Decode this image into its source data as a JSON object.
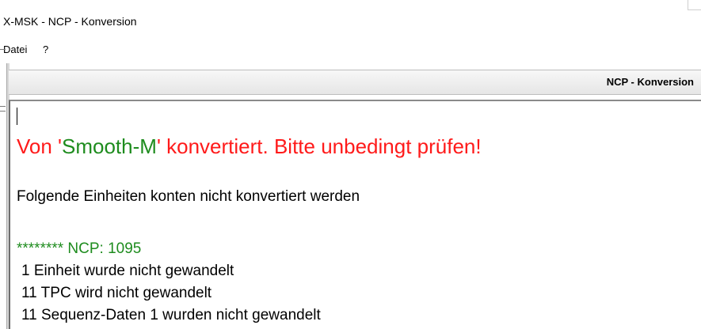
{
  "window": {
    "title": "X-MSK - NCP - Konversion"
  },
  "menu": {
    "items": [
      "Datei",
      "?"
    ]
  },
  "panel": {
    "title": "NCP - Konversion"
  },
  "content": {
    "headline": {
      "part1": "Von '",
      "source": "Smooth-M",
      "part2": "' konvertiert. Bitte unbedingt prüfen!"
    },
    "subheading": "Folgende Einheiten konten nicht konvertiert werden",
    "ncp_line": "******** NCP: 1095",
    "items": [
      " 1 Einheit wurde nicht gewandelt",
      "11 TPC wird nicht gewandelt",
      "11 Sequenz-Daten 1 wurden nicht gewandelt"
    ]
  },
  "colors": {
    "warning": "#ff1a1a",
    "highlight": "#1e8c1e"
  }
}
